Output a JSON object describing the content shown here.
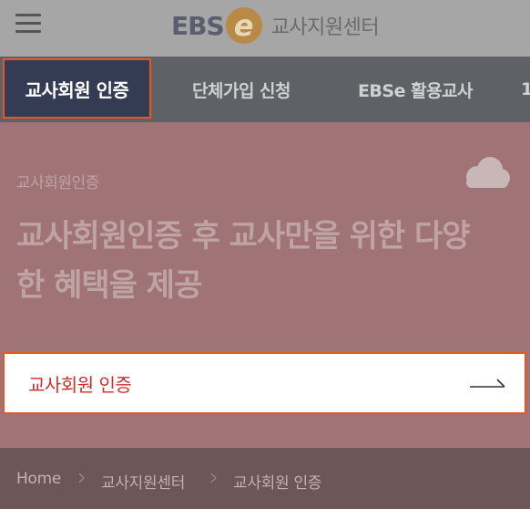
{
  "header": {
    "logo_text": "EBS",
    "logo_e": "e",
    "site_name": "교사지원센터"
  },
  "tabs": [
    {
      "label": "교사회원 인증",
      "active": true
    },
    {
      "label": "단체가입 신청"
    },
    {
      "label": "EBSe 활용교사"
    },
    {
      "label": "1"
    }
  ],
  "hero": {
    "subtitle": "교사회원인증",
    "headline": "교사회원인증 후 교사만을 위한 다양한 혜택을 제공"
  },
  "cta": {
    "label": "교사회원 인증"
  },
  "breadcrumb": [
    "Home",
    "교사지원센터",
    "교사회원 인증"
  ],
  "icons": {
    "menu": "hamburger-menu-icon",
    "cloud": "cloud-icon",
    "arrow": "long-arrow-right-icon",
    "separator": "chevron-right-icon"
  },
  "colors": {
    "accent": "#e9571e",
    "active_tab_bg": "#343c54",
    "cta_text": "#cc2e2e"
  }
}
